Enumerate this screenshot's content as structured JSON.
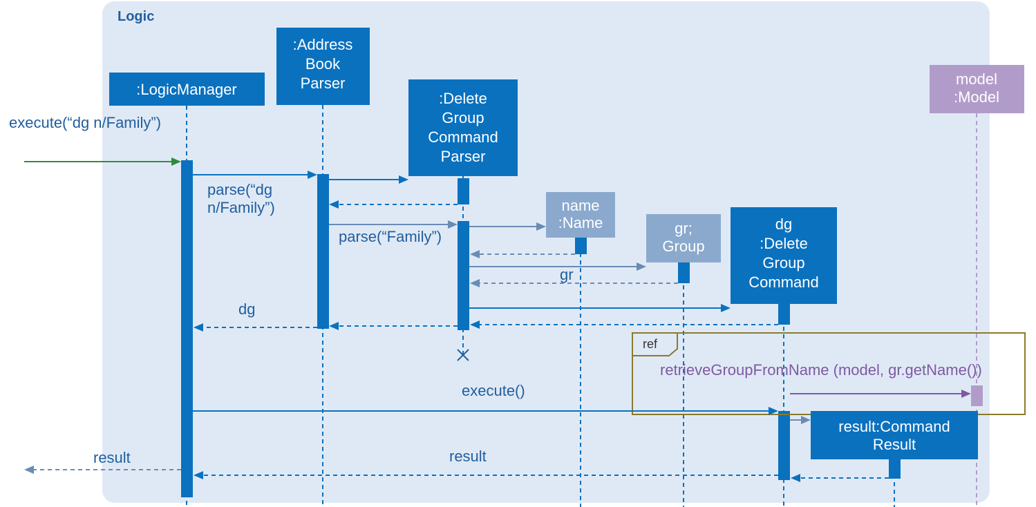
{
  "frame_title": "Logic",
  "lifelines": {
    "logic_manager": ":LogicManager",
    "address_book_parser_l1": ":Address",
    "address_book_parser_l2": "Book",
    "address_book_parser_l3": "Parser",
    "delete_group_command_parser_l1": ":Delete",
    "delete_group_command_parser_l2": "Group",
    "delete_group_command_parser_l3": "Command",
    "delete_group_command_parser_l4": "Parser",
    "name_l1": "name",
    "name_l2": ":Name",
    "gr_l1": "gr;",
    "gr_l2": "Group",
    "dg_l1": "dg",
    "dg_l2": ":Delete",
    "dg_l3": "Group",
    "dg_l4": "Command",
    "result_l1": "result:Command",
    "result_l2": "Result",
    "model_l1": "model",
    "model_l2": ":Model"
  },
  "messages": {
    "execute_entry": "execute(“dg n/Family”)",
    "parse_dg_l1": "parse(“dg",
    "parse_dg_l2": "n/Family”)",
    "parse_family": "parse(“Family”)",
    "gr": "gr",
    "dg_return": "dg",
    "execute": "execute()",
    "result": "result",
    "result_out": "result",
    "retrieve": "retrieveGroupFromName (model, gr.getName())"
  },
  "ref_label": "ref",
  "colors": {
    "primary": "#0a71bf",
    "secondary": "#8aa9cd",
    "purple": "#b19cc9",
    "frame_bg": "#dfe9f5",
    "ref_border": "#8a7a2a"
  },
  "chart_data": {
    "type": "sequence-diagram",
    "frame": "Logic",
    "lifelines": [
      {
        "id": "lm",
        "label": ":LogicManager",
        "kind": "primary",
        "created_at_start": true
      },
      {
        "id": "abp",
        "label": ":AddressBookParser",
        "kind": "primary",
        "created_at_start": true
      },
      {
        "id": "dgcp",
        "label": ":DeleteGroupCommandParser",
        "kind": "primary",
        "created_by": "abp"
      },
      {
        "id": "name",
        "label": "name:Name",
        "kind": "secondary",
        "created_by": "dgcp"
      },
      {
        "id": "gr",
        "label": "gr;Group",
        "kind": "secondary",
        "created_by": "dgcp"
      },
      {
        "id": "dg",
        "label": "dg:DeleteGroupCommand",
        "kind": "primary",
        "created_by": "dgcp"
      },
      {
        "id": "result",
        "label": "result:CommandResult",
        "kind": "primary",
        "created_by": "dg"
      },
      {
        "id": "model",
        "label": "model:Model",
        "kind": "external",
        "created_at_start": true
      }
    ],
    "messages": [
      {
        "from": "actor",
        "to": "lm",
        "label": "execute(“dg n/Family”)",
        "type": "call"
      },
      {
        "from": "lm",
        "to": "abp",
        "label": "parse(“dg n/Family”)",
        "type": "call"
      },
      {
        "from": "abp",
        "to": "dgcp",
        "label": "",
        "type": "create"
      },
      {
        "from": "dgcp",
        "to": "abp",
        "label": "",
        "type": "return"
      },
      {
        "from": "abp",
        "to": "dgcp",
        "label": "parse(“Family”)",
        "type": "call"
      },
      {
        "from": "dgcp",
        "to": "name",
        "label": "",
        "type": "create"
      },
      {
        "from": "name",
        "to": "dgcp",
        "label": "",
        "type": "return"
      },
      {
        "from": "dgcp",
        "to": "gr",
        "label": "gr",
        "type": "create"
      },
      {
        "from": "gr",
        "to": "dgcp",
        "label": "",
        "type": "return"
      },
      {
        "from": "dgcp",
        "to": "dg",
        "label": "",
        "type": "create"
      },
      {
        "from": "dg",
        "to": "dgcp",
        "label": "",
        "type": "return"
      },
      {
        "from": "dgcp",
        "to": "abp",
        "label": "",
        "type": "return"
      },
      {
        "from": "abp",
        "to": "lm",
        "label": "dg",
        "type": "return"
      },
      {
        "note": "dgcp destroyed (X)"
      },
      {
        "ref": "retrieveGroupFromName (model, gr.getName())",
        "over": [
          "dg",
          "model"
        ]
      },
      {
        "from": "lm",
        "to": "dg",
        "label": "execute()",
        "type": "call"
      },
      {
        "from": "dg",
        "to": "result",
        "label": "",
        "type": "create"
      },
      {
        "from": "result",
        "to": "dg",
        "label": "",
        "type": "return"
      },
      {
        "from": "dg",
        "to": "lm",
        "label": "result",
        "type": "return"
      },
      {
        "from": "lm",
        "to": "actor",
        "label": "result",
        "type": "return"
      }
    ]
  }
}
